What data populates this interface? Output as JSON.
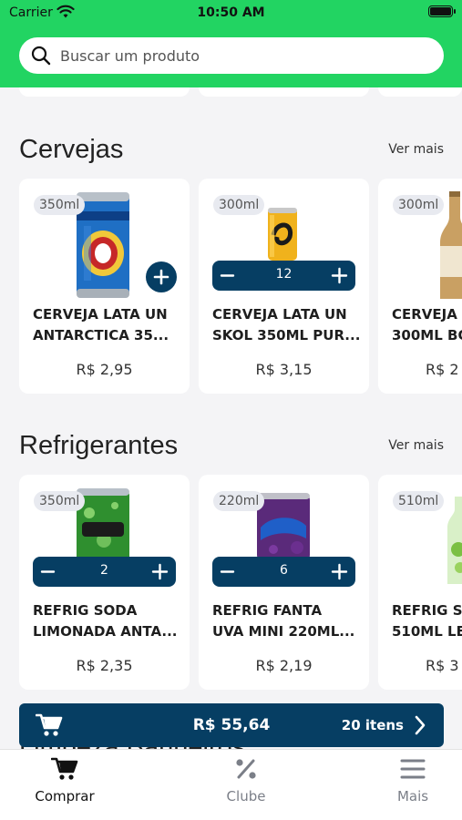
{
  "status_bar": {
    "carrier": "Carrier",
    "time": "10:50 AM"
  },
  "search": {
    "placeholder": "Buscar um produto"
  },
  "sections": [
    {
      "title": "Cervejas",
      "see_more": "Ver mais",
      "products": [
        {
          "size": "350ml",
          "name": "CERVEJA LATA UN\nANTARCTICA 35...",
          "price": "R$ 2,95",
          "control": "add",
          "image": "antarctica-can"
        },
        {
          "size": "300ml",
          "name": "CERVEJA LATA UN\nSKOL 350ML PUR...",
          "price": "R$ 3,15",
          "control": "stepper",
          "quantity": "12",
          "image": "skol-can"
        },
        {
          "size": "300ml",
          "name": "CERVEJA\n300ML BO",
          "price": "R$ 2",
          "control": "none",
          "image": "beer-bottle"
        }
      ]
    },
    {
      "title": "Refrigerantes",
      "see_more": "Ver mais",
      "products": [
        {
          "size": "350ml",
          "name": "REFRIG SODA\nLIMONADA ANTA...",
          "price": "R$ 2,35",
          "control": "stepper",
          "quantity": "2",
          "image": "soda-can"
        },
        {
          "size": "220ml",
          "name": "REFRIG FANTA\nUVA MINI 220ML...",
          "price": "R$ 2,19",
          "control": "stepper",
          "quantity": "6",
          "image": "fanta-can"
        },
        {
          "size": "510ml",
          "name": "REFRIG SP\n510ML LE",
          "price": "R$ 3",
          "control": "none",
          "image": "lime-bottle"
        }
      ]
    }
  ],
  "next_section_partial": "Limpeza Banheiros",
  "cart": {
    "total": "R$ 55,64",
    "count": "20 itens"
  },
  "tabs": [
    {
      "label": "Comprar",
      "icon": "cart-icon",
      "active": true
    },
    {
      "label": "Clube",
      "icon": "percent-icon",
      "active": false
    },
    {
      "label": "Mais",
      "icon": "menu-icon",
      "active": false
    }
  ],
  "colors": {
    "brand_green": "#22d462",
    "primary_navy": "#063e63",
    "background": "#f4f4f6"
  }
}
